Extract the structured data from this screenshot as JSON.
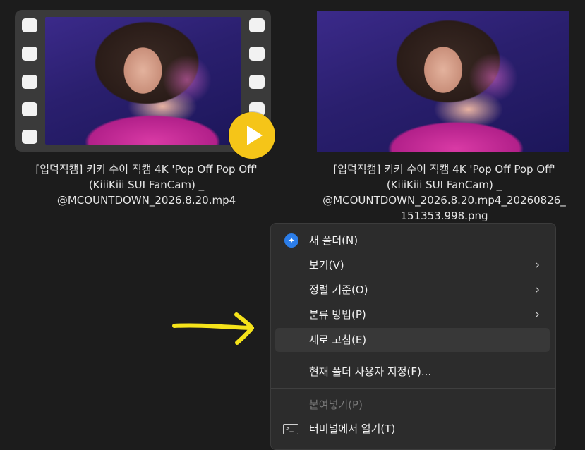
{
  "files": [
    {
      "name_lines": [
        "[입덕직캠] 키키 수이 직캠 4K 'Pop Off Pop Off'",
        "(KiiiKiii SUI FanCam) _",
        "@MCOUNTDOWN_2026.8.20.mp4"
      ],
      "thumbnail": "video-thumbnail",
      "icon": "play-icon"
    },
    {
      "name_lines": [
        "[입덕직캠] 키키 수이 직캠 4K 'Pop Off Pop Off'",
        "(KiiiKiii SUI FanCam) _",
        "@MCOUNTDOWN_2026.8.20.mp4_20260826_",
        "151353.998.png"
      ],
      "thumbnail": "image-thumbnail"
    }
  ],
  "context_menu": {
    "items": [
      {
        "label": "새 폴더(N)",
        "icon": "new-folder-icon"
      },
      {
        "label": "보기(V)",
        "submenu": true
      },
      {
        "label": "정렬 기준(O)",
        "submenu": true
      },
      {
        "label": "분류 방법(P)",
        "submenu": true
      },
      {
        "label": "새로 고침(E)",
        "hovered": true
      },
      {
        "label": "현재 폴더 사용자 지정(F)..."
      },
      {
        "label": "붙여넣기(P)",
        "disabled": true
      },
      {
        "label": "터미널에서 열기(T)",
        "icon": "terminal-icon"
      }
    ],
    "chevron": "›",
    "new_folder_glyph": "✦",
    "terminal_glyph": ">_"
  },
  "annotation": {
    "arrow_color": "#f5e31a",
    "icon": "arrow-right-icon"
  },
  "colors": {
    "background": "#1c1c1c",
    "menu": "#2c2c2c",
    "accent": "#2b7de9",
    "play": "#f5c518"
  }
}
